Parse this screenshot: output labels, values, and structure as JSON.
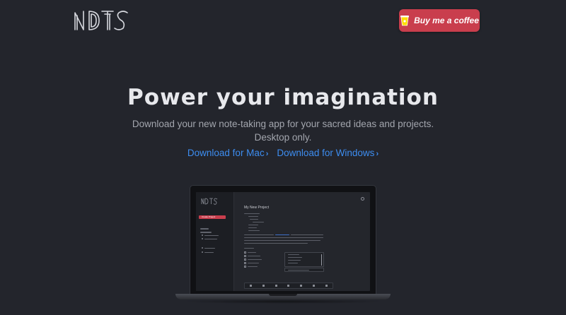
{
  "header": {
    "logo_text": "NDTS",
    "coffee_button_label": "Buy me a coffee"
  },
  "hero": {
    "title": "Power your imagination",
    "subtitle_line1": "Download your new note-taking app for your sacred ideas and projects.",
    "subtitle_line2": "Desktop only.",
    "links": [
      {
        "label": "Download for Mac",
        "icon": "chevron-right-icon"
      },
      {
        "label": "Download for Windows",
        "icon": "chevron-right-icon"
      }
    ]
  },
  "mockup": {
    "app_title": "My New Project",
    "create_button": "Create Project"
  },
  "colors": {
    "background": "#23252c",
    "accent_red": "#c93e4d",
    "link_blue": "#3d8df0"
  }
}
